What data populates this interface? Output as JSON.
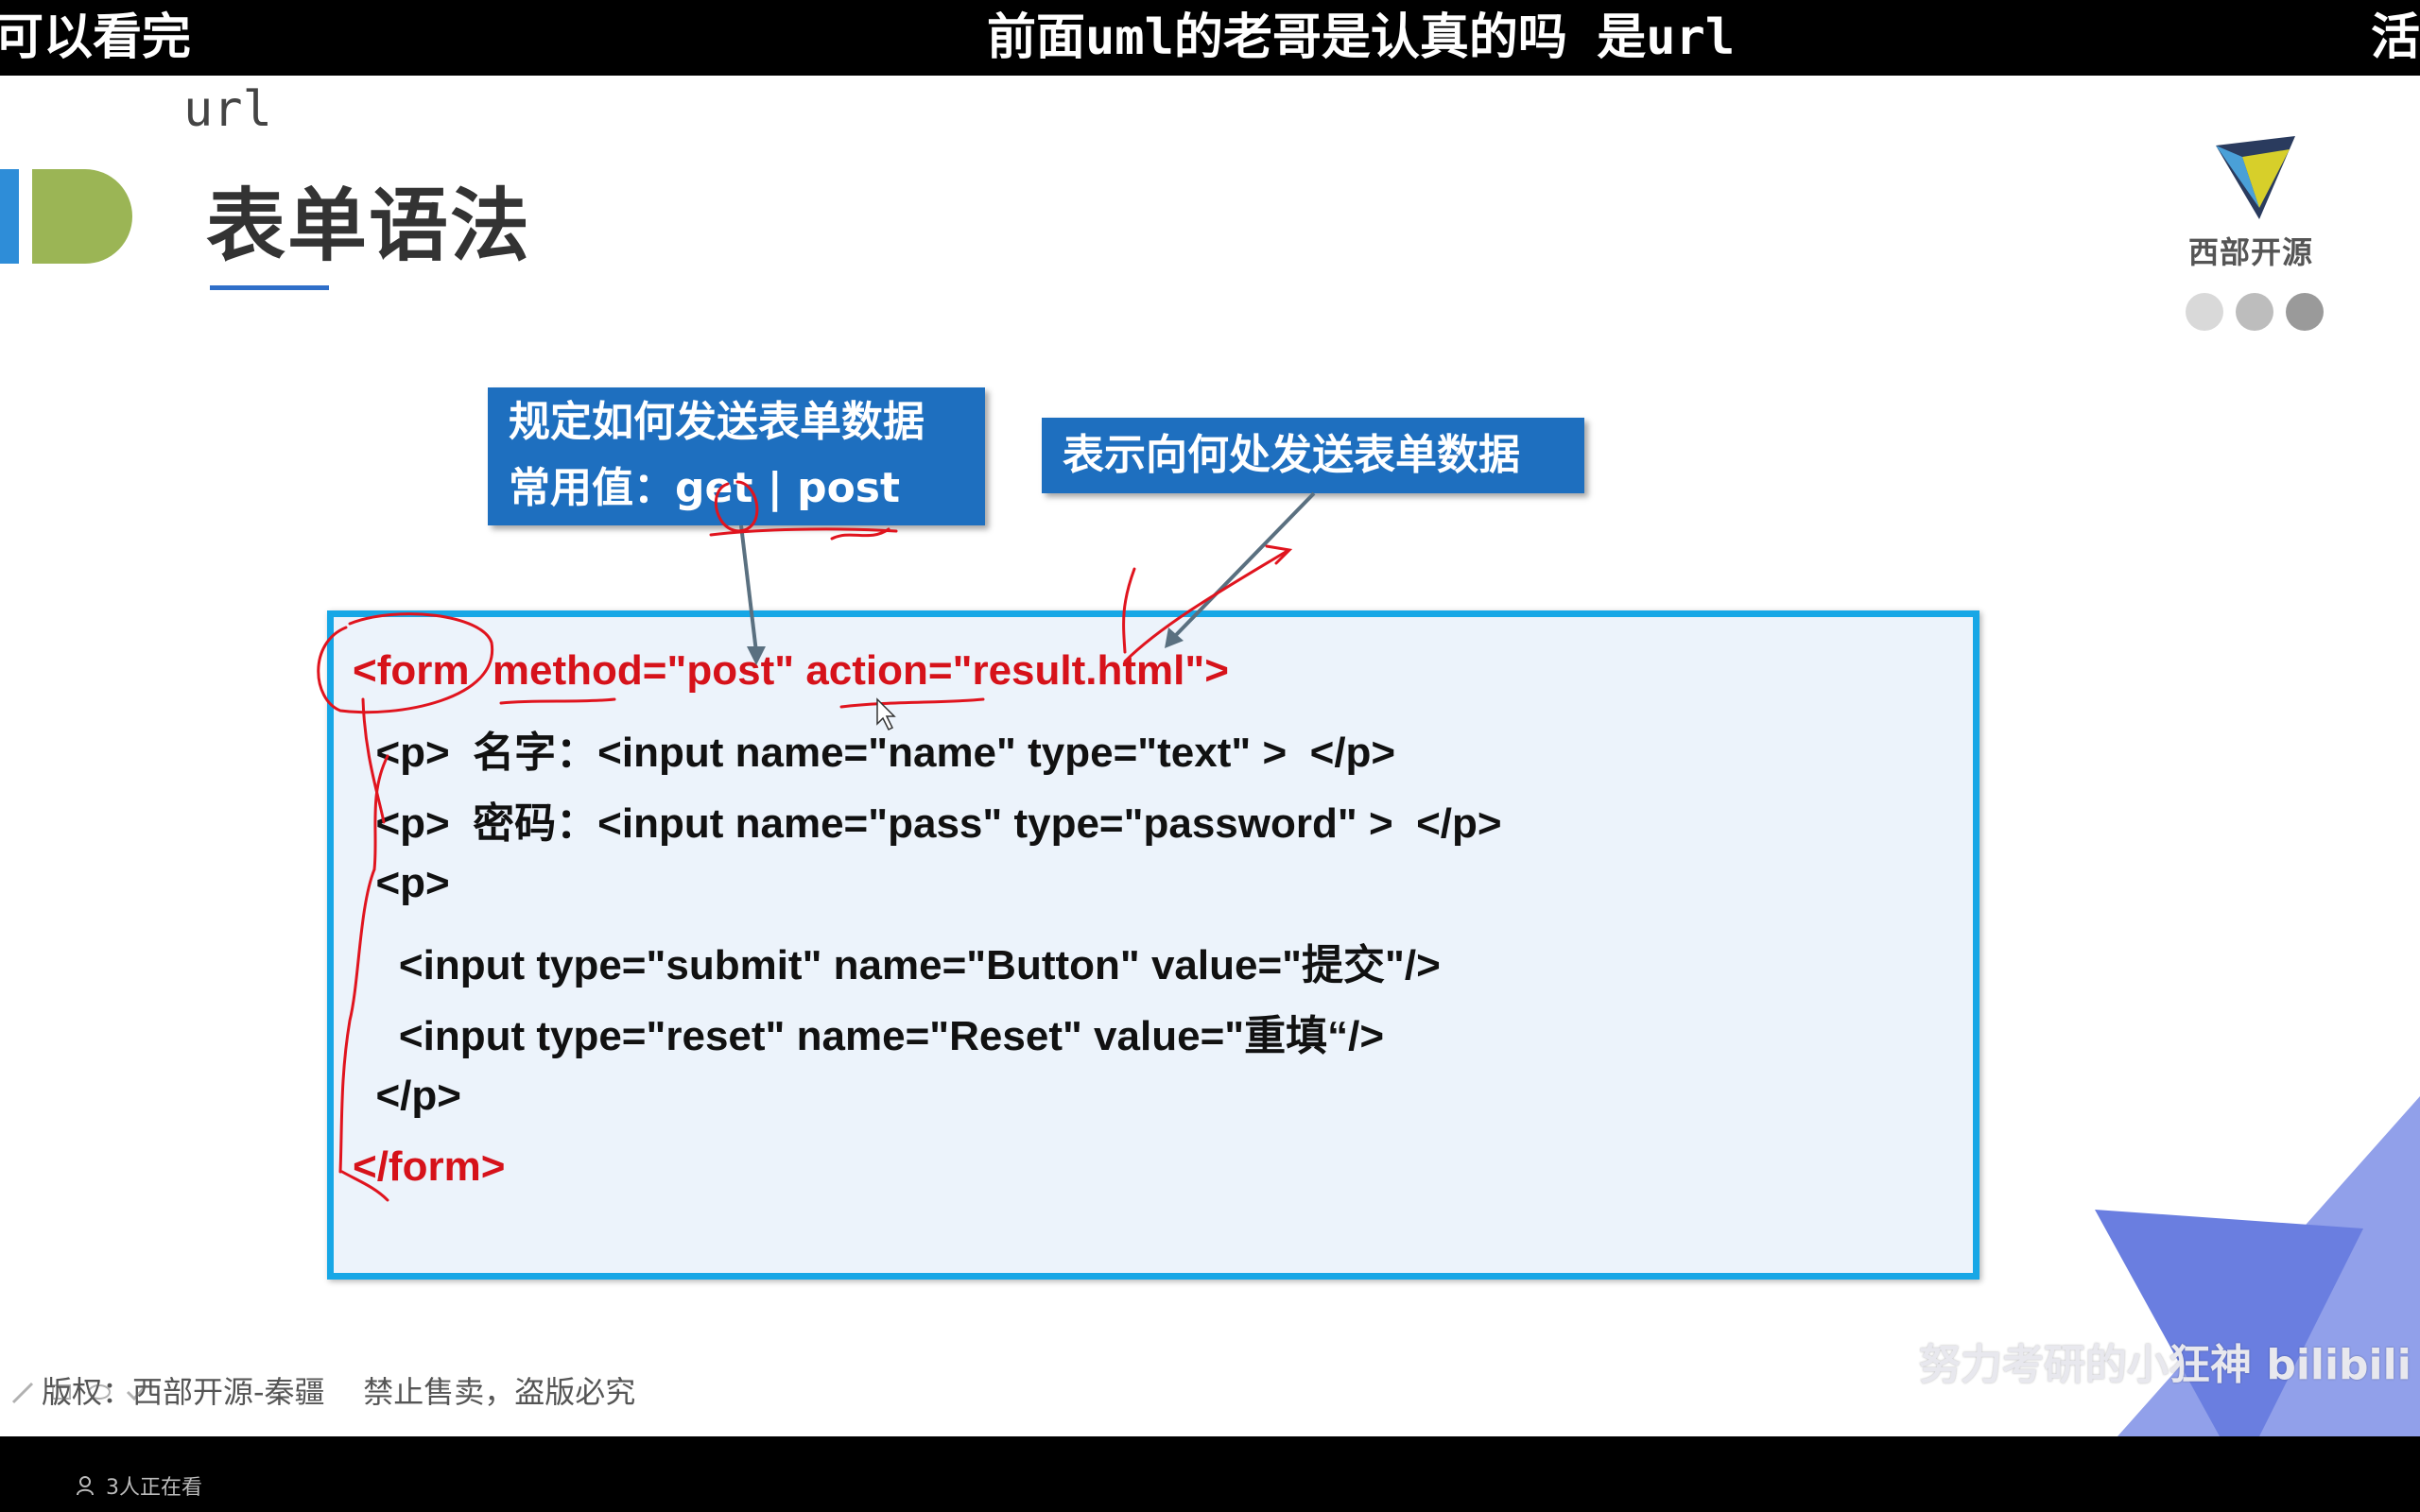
{
  "danmaku": {
    "left": "可以看完",
    "center": "前面uml的老哥是认真的吗 是url",
    "right": "活"
  },
  "slide": {
    "title": "表单语法",
    "annotation": "url",
    "logo_text": "西部开源",
    "dots": [
      "#d9d9d9",
      "#bdbdbd",
      "#9a9a9a"
    ],
    "callout_method": {
      "line1": "规定如何发送表单数据",
      "line2": "常用值：get | post"
    },
    "callout_action": "表示向何处发送表单数据",
    "code_lines": [
      "<form  method=\"post\" action=\"result.html\">",
      "  <p>  名字：<input name=\"name\" type=\"text\" >  </p>",
      "  <p>  密码：<input name=\"pass\" type=\"password\" >  </p>",
      "  <p>",
      "    <input type=\"submit\" name=\"Button\" value=\"提交\"/>",
      "    <input type=\"reset\" name=\"Reset\" value=\"重填“/>",
      "  </p>",
      "</form>"
    ],
    "copyright": "版权：西部开源-秦疆    禁止售卖，盗版必究",
    "watermark": "努力考研的小狂神 bilibili"
  },
  "bottom": {
    "viewers": "3人正在看"
  },
  "colors": {
    "accent_blue": "#1e6fbf",
    "code_border": "#17a7e6",
    "code_red": "#d6121a",
    "annotation_red": "#e0141e"
  }
}
